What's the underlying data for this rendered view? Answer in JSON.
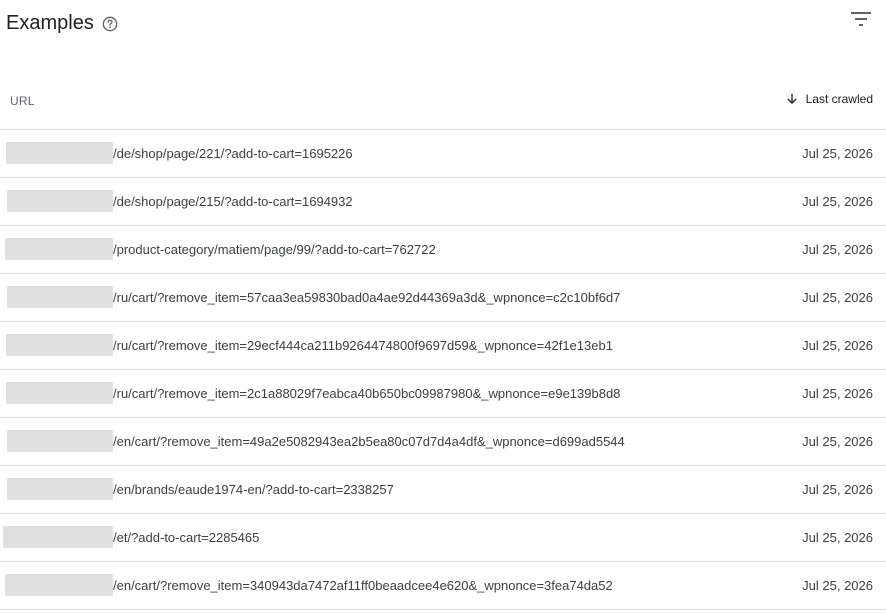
{
  "header": {
    "title": "Examples",
    "help_icon": "help-circle-icon",
    "filter_icon": "filter-icon"
  },
  "table": {
    "columns": {
      "url": "URL",
      "last_crawled": "Last crawled",
      "sort_icon": "arrow-down-icon"
    },
    "rows": [
      {
        "url": "/de/shop/page/221/?add-to-cart=1695226",
        "date": "Jul 25, 2026"
      },
      {
        "url": "/de/shop/page/215/?add-to-cart=1694932",
        "date": "Jul 25, 2026"
      },
      {
        "url": "/product-category/matiem/page/99/?add-to-cart=762722",
        "date": "Jul 25, 2026"
      },
      {
        "url": "/ru/cart/?remove_item=57caa3ea59830bad0a4ae92d44369a3d&_wpnonce=c2c10bf6d7",
        "date": "Jul 25, 2026"
      },
      {
        "url": "/ru/cart/?remove_item=29ecf444ca211b9264474800f9697d59&_wpnonce=42f1e13eb1",
        "date": "Jul 25, 2026"
      },
      {
        "url": "/ru/cart/?remove_item=2c1a88029f7eabca40b650bc09987980&_wpnonce=e9e139b8d8",
        "date": "Jul 25, 2026"
      },
      {
        "url": "/en/cart/?remove_item=49a2e5082943ea2b5ea80c07d7d4a4df&_wpnonce=d699ad5544",
        "date": "Jul 25, 2026"
      },
      {
        "url": "/en/brands/eaude1974-en/?add-to-cart=2338257",
        "date": "Jul 25, 2026"
      },
      {
        "url": "/et/?add-to-cart=2285465",
        "date": "Jul 25, 2026"
      },
      {
        "url": "/en/cart/?remove_item=340943da7472af11ff0beaadcee4e620&_wpnonce=3fea74da52",
        "date": "Jul 25, 2026"
      }
    ]
  }
}
